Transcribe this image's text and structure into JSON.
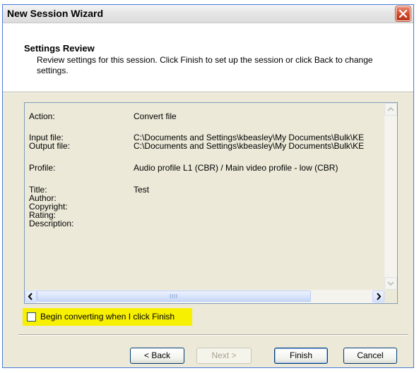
{
  "window": {
    "title": "New Session Wizard"
  },
  "header": {
    "title": "Settings Review",
    "description": "Review settings for this session. Click Finish to set up the session or click Back to change settings."
  },
  "summary": {
    "rows": [
      {
        "label": "Action:",
        "value": "Convert file"
      },
      {
        "label": "Input file:",
        "value": "C:\\Documents and Settings\\kbeasley\\My Documents\\Bulk\\KE"
      },
      {
        "label": "Output file:",
        "value": "C:\\Documents and Settings\\kbeasley\\My Documents\\Bulk\\KE"
      },
      {
        "label": "Profile:",
        "value": "Audio profile L1 (CBR) / Main video profile - low (CBR)"
      },
      {
        "label": "Title:",
        "value": "Test"
      },
      {
        "label": "Author:",
        "value": ""
      },
      {
        "label": "Copyright:",
        "value": ""
      },
      {
        "label": "Rating:",
        "value": ""
      },
      {
        "label": "Description:",
        "value": ""
      }
    ]
  },
  "checkbox": {
    "label": "Begin converting when I click Finish",
    "checked": false,
    "highlight_color": "#f7f000"
  },
  "buttons": {
    "back": "< Back",
    "next": "Next >",
    "finish": "Finish",
    "cancel": "Cancel"
  },
  "icons": {
    "close": "close-icon",
    "scroll_up": "arrow-up-icon",
    "scroll_down": "arrow-down-icon",
    "scroll_left": "arrow-left-icon",
    "scroll_right": "arrow-right-icon",
    "grip": "grip-icon"
  }
}
